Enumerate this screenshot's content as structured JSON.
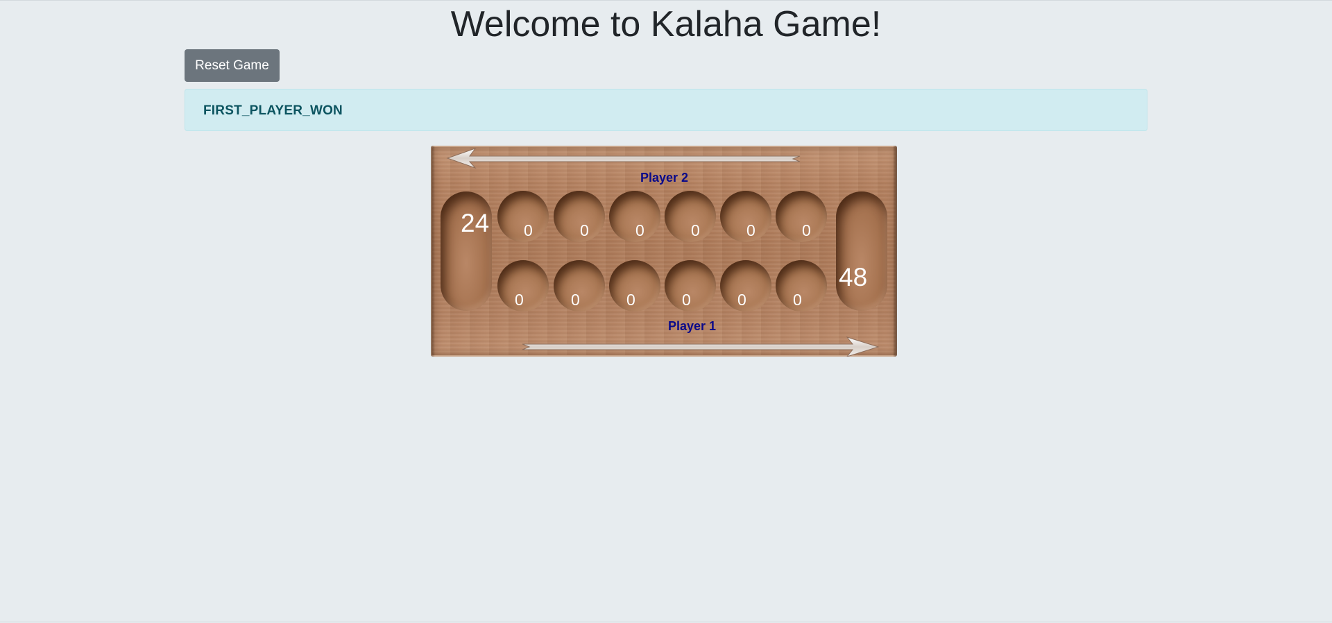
{
  "page": {
    "title": "Welcome to Kalaha Game!"
  },
  "controls": {
    "reset_label": "Reset Game"
  },
  "status": {
    "message": "FIRST_PLAYER_WON"
  },
  "board": {
    "player2_label": "Player 2",
    "player1_label": "Player 1",
    "player2_store": "24",
    "player1_store": "48",
    "player2_pits": [
      "0",
      "0",
      "0",
      "0",
      "0",
      "0"
    ],
    "player1_pits": [
      "0",
      "0",
      "0",
      "0",
      "0",
      "0"
    ]
  },
  "colors": {
    "background": "#e7ecef",
    "button": "#6c757d",
    "alert_bg": "#d1ecf1",
    "alert_text": "#0c5460",
    "player_label": "#0a0a8a"
  }
}
